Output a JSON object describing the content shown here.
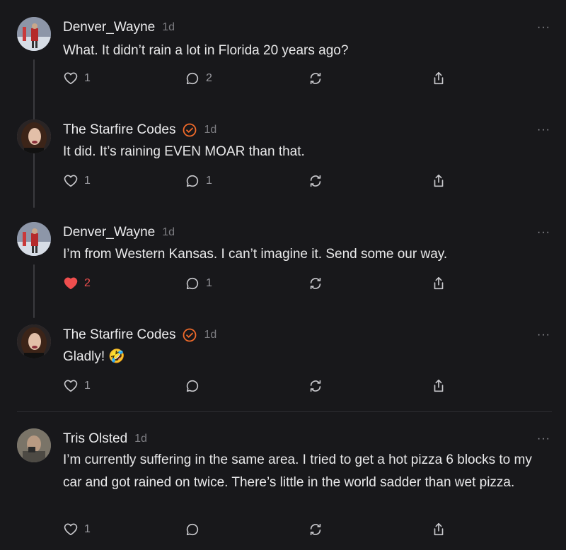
{
  "colors": {
    "background": "#18181b",
    "verified_accent": "#f26b2a",
    "liked_heart": "#ef4e4e"
  },
  "comments": [
    {
      "author": "Denver_Wayne",
      "time": "1d",
      "verified": false,
      "text": "What. It didn’t rain a lot in Florida 20 years ago?",
      "likes": "1",
      "liked": false,
      "replies": "2",
      "more": "···"
    },
    {
      "author": "The Starfire Codes",
      "time": "1d",
      "verified": true,
      "text": "It did. It’s raining EVEN MOAR than that.",
      "likes": "1",
      "liked": false,
      "replies": "1",
      "more": "···"
    },
    {
      "author": "Denver_Wayne",
      "time": "1d",
      "verified": false,
      "text": "I’m from Western Kansas. I can’t imagine it. Send some our way.",
      "likes": "2",
      "liked": true,
      "replies": "1",
      "more": "···"
    },
    {
      "author": "The Starfire Codes",
      "time": "1d",
      "verified": true,
      "text": "Gladly! 🤣",
      "likes": "1",
      "liked": false,
      "replies": "",
      "more": "···"
    },
    {
      "author": "Tris Olsted",
      "time": "1d",
      "verified": false,
      "text": "I’m currently suffering in the same area. I tried to get a hot pizza 6 blocks to my car and got rained on twice. There’s little in the world sadder than wet pizza.",
      "likes": "1",
      "liked": false,
      "replies": "",
      "more": "···"
    }
  ]
}
